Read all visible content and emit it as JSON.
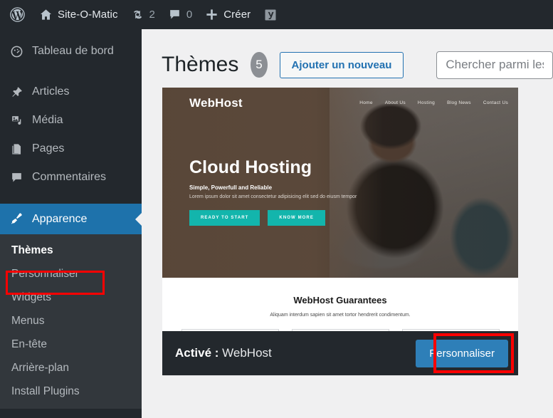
{
  "adminbar": {
    "wp_logo": "wordpress-logo-icon",
    "site_name": "Site-O-Matic",
    "home_icon": "home-icon",
    "updates_icon": "updates-icon",
    "updates_count": "2",
    "comments_icon": "comment-bubble-icon",
    "comments_count": "0",
    "new_icon": "plus-icon",
    "new_label": "Créer",
    "yoast_icon": "yoast-seo-icon"
  },
  "sidebar": {
    "items": [
      {
        "label": "Tableau de bord",
        "icon": "dashboard-icon",
        "slug": "dashboard"
      },
      {
        "label": "Articles",
        "icon": "pin-icon",
        "slug": "posts"
      },
      {
        "label": "Média",
        "icon": "media-icon",
        "slug": "media"
      },
      {
        "label": "Pages",
        "icon": "pages-icon",
        "slug": "pages"
      },
      {
        "label": "Commentaires",
        "icon": "comment-icon",
        "slug": "comments"
      },
      {
        "label": "Apparence",
        "icon": "paintbrush-icon",
        "slug": "appearance",
        "current": true
      }
    ],
    "submenu": [
      {
        "label": "Thèmes",
        "active": true
      },
      {
        "label": "Personnaliser",
        "highlighted": true
      },
      {
        "label": "Widgets"
      },
      {
        "label": "Menus"
      },
      {
        "label": "En-tête"
      },
      {
        "label": "Arrière-plan"
      },
      {
        "label": "Install Plugins"
      }
    ]
  },
  "header": {
    "title": "Thèmes",
    "count": "5",
    "add_new_label": "Ajouter un nouveau",
    "search_placeholder": "Chercher parmi les thèmes...",
    "search_value": ""
  },
  "theme_card": {
    "active_prefix": "Activé :",
    "theme_name": "WebHost",
    "customize_label": "Personnaliser",
    "preview": {
      "brand": "WebHost",
      "nav": [
        "Home",
        "About Us",
        "Hosting",
        "Blog News",
        "Contact Us"
      ],
      "hero_title": "Cloud Hosting",
      "hero_subtitle": "Simple, Powerfull and Reliable",
      "hero_text": "Lorem ipsum dolor sit amet consectetur adipisicing elit sed do eiusm tempor",
      "hero_buttons": [
        "READY TO START",
        "KNOW MORE"
      ],
      "section_title": "WebHost Guarantees",
      "section_subtitle": "Aliquam interdum sapien sit amet tortor hendrerit condimentum."
    }
  },
  "annotations": {
    "highlight_color": "#fe0000",
    "boxes": [
      "personnaliser-menu-item",
      "personnaliser-button"
    ]
  },
  "colors": {
    "admin_dark": "#23282d",
    "submenu_dark": "#32373c",
    "accent_blue": "#1e72ab",
    "button_blue": "#2e7fb8",
    "link_blue": "#2271b1",
    "content_bg": "#f0f0f1",
    "theme_teal": "#13b5ac",
    "highlight_red": "#fe0000"
  }
}
